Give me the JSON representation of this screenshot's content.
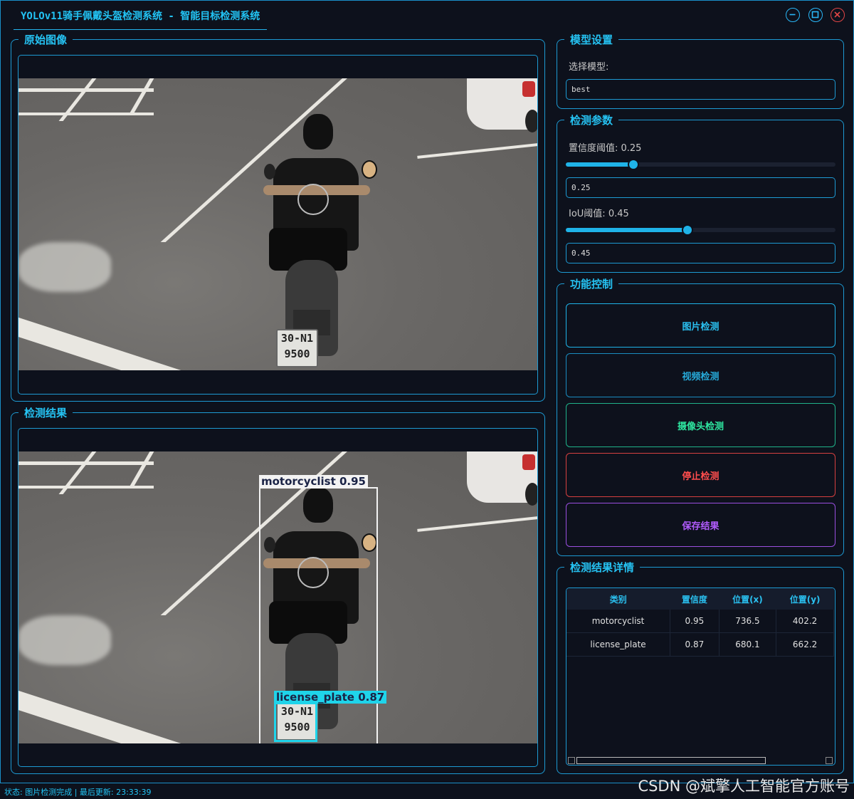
{
  "window": {
    "title": "YOLOv11骑手佩戴头盔检测系统 - 智能目标检测系统"
  },
  "original_image": {
    "legend": "原始图像"
  },
  "result_image": {
    "legend": "检测结果",
    "detections": [
      {
        "label": "motorcyclist 0.95"
      },
      {
        "label": "license_plate 0.87"
      }
    ]
  },
  "plate": {
    "line1": "30-N1",
    "line2": "9500"
  },
  "model_settings": {
    "legend": "模型设置",
    "select_label": "选择模型:",
    "model_value": "best"
  },
  "params": {
    "legend": "检测参数",
    "conf_label": "置信度阈值: 0.25",
    "conf_value": "0.25",
    "conf_level": 0.25,
    "iou_label": "IoU阈值: 0.45",
    "iou_value": "0.45",
    "iou_level": 0.45
  },
  "controls": {
    "legend": "功能控制",
    "image_detect": "图片检测",
    "video_detect": "视频检测",
    "camera_detect": "摄像头检测",
    "stop_detect": "停止检测",
    "save_result": "保存结果"
  },
  "details": {
    "legend": "检测结果详情",
    "columns": [
      "类别",
      "置信度",
      "位置(x)",
      "位置(y)"
    ],
    "rows": [
      [
        "motorcyclist",
        "0.95",
        "736.5",
        "402.2"
      ],
      [
        "license_plate",
        "0.87",
        "680.1",
        "662.2"
      ]
    ]
  },
  "status": {
    "text": "状态: 图片检测完成 | 最后更新: 23:33:39"
  },
  "watermark": "CSDN @斌擎人工智能官方账号",
  "colors": {
    "accent": "#22c4f5",
    "camera": "#2ee6a0",
    "stop": "#ff4d4d",
    "save": "#b35cff"
  }
}
